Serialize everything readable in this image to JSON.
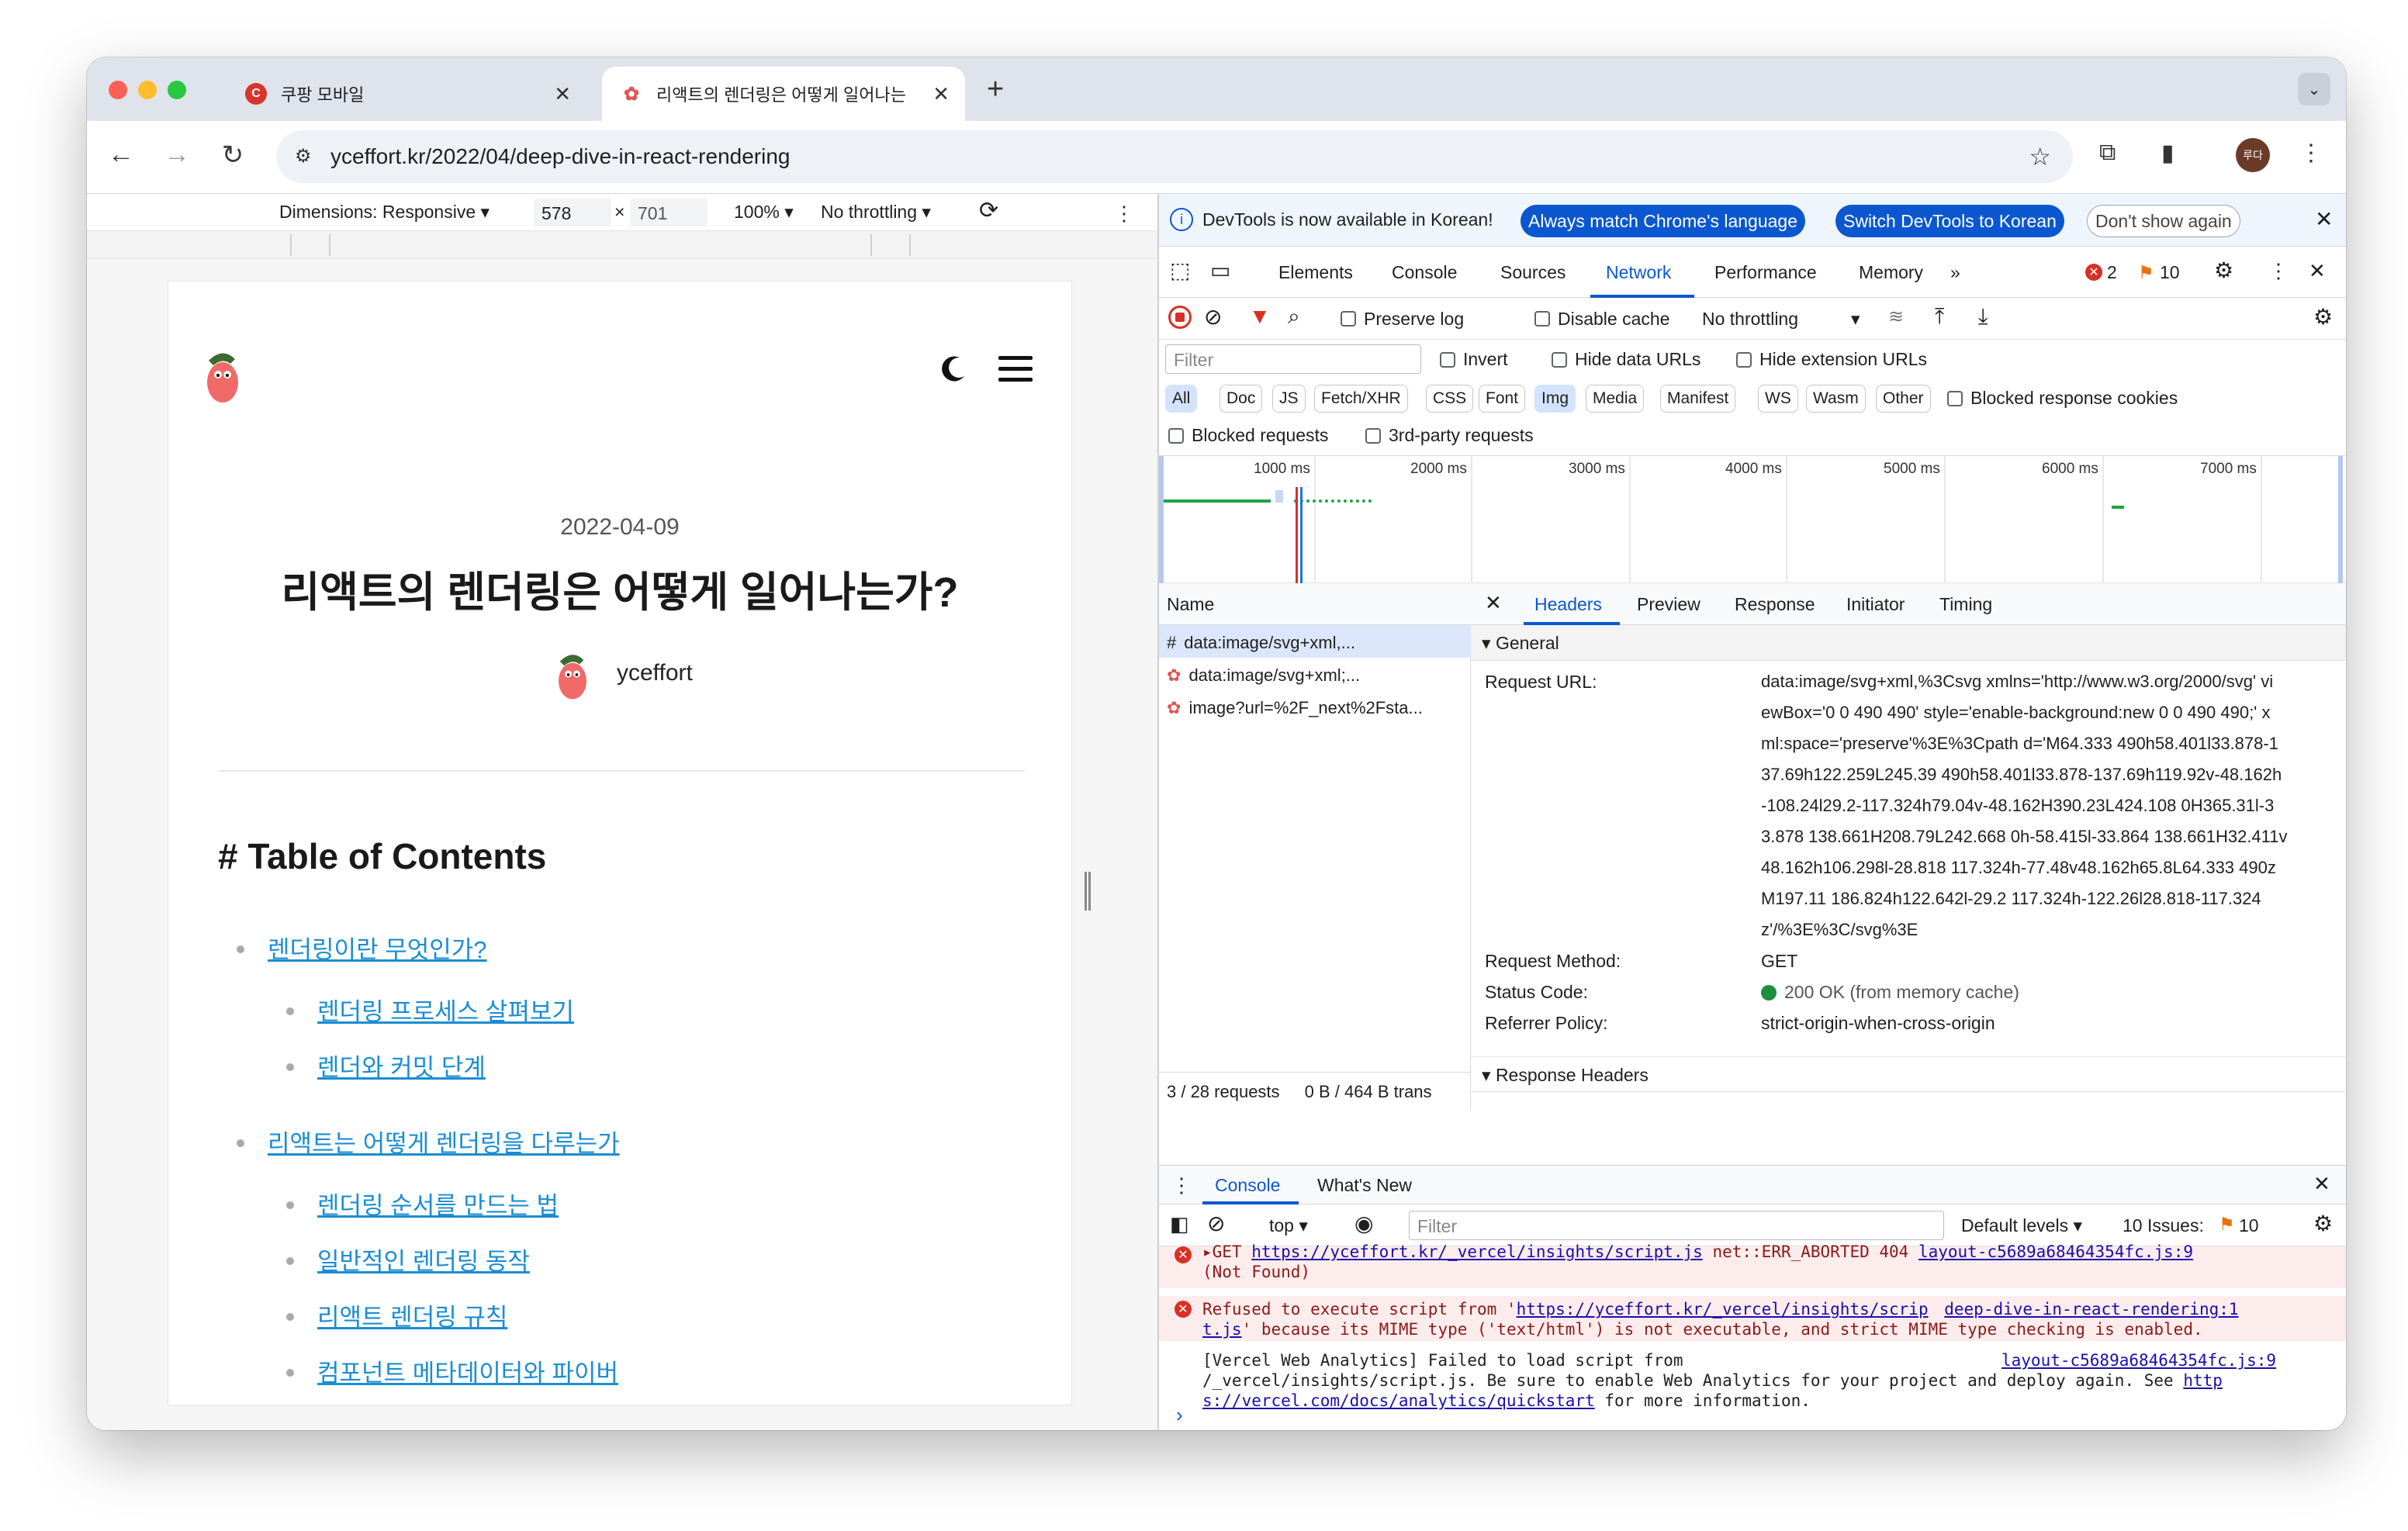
{
  "browser": {
    "tabs": [
      {
        "label": "쿠팡 모바일",
        "favicon": "C"
      },
      {
        "label": "리액트의 렌더링은 어떻게 일어나는"
      }
    ],
    "url": "yceffort.kr/2022/04/deep-dive-in-react-rendering",
    "profile": "루다"
  },
  "device_toolbar": {
    "dimensions": "Dimensions: Responsive ▾",
    "width": "578",
    "x": "×",
    "height": "701",
    "zoom": "100% ▾",
    "throttle": "No throttling ▾"
  },
  "blog": {
    "date": "2022-04-09",
    "title": "리액트의 렌더링은 어떻게 일어나는가?",
    "author": "yceffort",
    "toc_title": "# Table of Contents",
    "toc": [
      {
        "label": "렌더링이란 무엇인가?",
        "level": 1
      },
      {
        "label": "렌더링 프로세스 살펴보기",
        "level": 2
      },
      {
        "label": "렌더와 커밋 단계",
        "level": 2
      },
      {
        "label": "리액트는 어떻게 렌더링을 다루는가",
        "level": 1
      },
      {
        "label": "렌더링 순서를 만드는 법",
        "level": 2
      },
      {
        "label": "일반적인 렌더링 동작",
        "level": 2
      },
      {
        "label": "리액트 렌더링 규칙",
        "level": 2
      },
      {
        "label": "컴포넌트 메타데이터와 파이버",
        "level": 2
      }
    ]
  },
  "devtools": {
    "infobar": {
      "message": "DevTools is now available in Korean!",
      "btn_match": "Always match Chrome's language",
      "btn_switch": "Switch DevTools to Korean",
      "btn_dont": "Don't show again"
    },
    "tabs": [
      "Elements",
      "Console",
      "Sources",
      "Network",
      "Performance",
      "Memory",
      "»"
    ],
    "errors_count": "2",
    "issues_count": "10",
    "network_toolbar": {
      "preserve_log": "Preserve log",
      "disable_cache": "Disable cache",
      "throttling": "No throttling"
    },
    "filter": {
      "placeholder": "Filter",
      "invert": "Invert",
      "hide_data_urls": "Hide data URLs",
      "hide_ext_urls": "Hide extension URLs",
      "types": [
        "All",
        "Doc",
        "JS",
        "Fetch/XHR",
        "CSS",
        "Font",
        "Img",
        "Media",
        "Manifest",
        "WS",
        "Wasm",
        "Other"
      ],
      "blocked_cookies": "Blocked response cookies",
      "blocked_requests": "Blocked requests",
      "third_party": "3rd-party requests"
    },
    "timeline_labels": [
      "1000 ms",
      "2000 ms",
      "3000 ms",
      "4000 ms",
      "5000 ms",
      "6000 ms",
      "7000 ms"
    ],
    "requests": {
      "header": "Name",
      "rows": [
        "data:image/svg+xml,...",
        "data:image/svg+xml;...",
        "image?url=%2F_next%2Fsta..."
      ],
      "footer_count": "3 / 28 requests",
      "footer_size": "0 B / 464 B trans"
    },
    "detail_tabs": [
      "Headers",
      "Preview",
      "Response",
      "Initiator",
      "Timing"
    ],
    "general": {
      "section": "General",
      "url_label": "Request URL:",
      "url_lines": [
        "data:image/svg+xml,%3Csvg xmlns='http://www.w3.org/2000/svg' vi",
        "ewBox='0 0 490 490' style='enable-background:new 0 0 490 490;' x",
        "ml:space='preserve'%3E%3Cpath d='M64.333 490h58.401l33.878-1",
        "37.69h122.259L245.39 490h58.401l33.878-137.69h119.92v-48.162h",
        "-108.24l29.2-117.324h79.04v-48.162H390.23L424.108 0H365.31l-3",
        "3.878 138.661H208.79L242.668 0h-58.415l-33.864 138.661H32.411v",
        "48.162h106.298l-28.818 117.324h-77.48v48.162h65.8L64.333 490z",
        "M197.11 186.824h122.642l-29.2 117.324h-122.26l28.818-117.324",
        "z'/%3E%3C/svg%3E"
      ],
      "method_label": "Request Method:",
      "method": "GET",
      "status_label": "Status Code:",
      "status": "200 OK (from memory cache)",
      "referrer_label": "Referrer Policy:",
      "referrer": "strict-origin-when-cross-origin",
      "response_headers": "Response Headers"
    },
    "console": {
      "tabs": [
        "Console",
        "What's New"
      ],
      "context": "top ▾",
      "filter_placeholder": "Filter",
      "levels": "Default levels ▾",
      "issues_label": "10 Issues:",
      "issues_count": "10",
      "msg1_a": "▸GET ",
      "msg1_link": "https://yceffort.kr/_vercel/insights/script.js",
      "msg1_b": " net::ERR_ABORTED 404 ",
      "msg1_src": "layout-c5689a68464354fc.js:9",
      "msg1_c": "(Not Found)",
      "msg2_a": "Refused to execute script from '",
      "msg2_link": "https://yceffort.kr/_vercel/insights/scrip",
      "msg2_src": "deep-dive-in-react-rendering:1",
      "msg2_link2": "t.js",
      "msg2_b": "' because its MIME type ('text/html') is not executable, and strict MIME type checking is enabled.",
      "msg3_a": "[Vercel Web Analytics] Failed to load script from",
      "msg3_src": "layout-c5689a68464354fc.js:9",
      "msg3_b": "/_vercel/insights/script.js. Be sure to enable Web Analytics for your project and deploy again. See ",
      "msg3_link1": "http",
      "msg3_link2": "s://vercel.com/docs/analytics/quickstart",
      "msg3_c": " for more information.",
      "prompt": "›"
    }
  },
  "colors": {
    "accent": "#0b57d0",
    "link": "#1a8dd3",
    "error": "#d93025"
  }
}
